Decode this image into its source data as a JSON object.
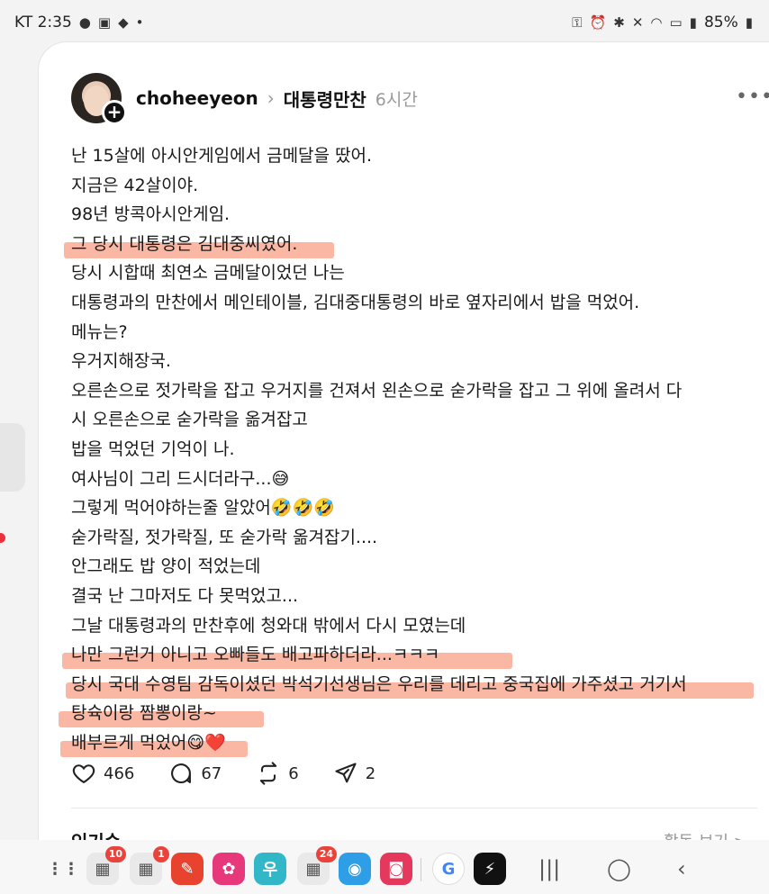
{
  "status_bar": {
    "carrier_time": "KT 2:35",
    "left_icons": [
      "location-icon",
      "gallery-icon",
      "chat-icon"
    ],
    "dot": "•",
    "battery": "85%"
  },
  "post": {
    "author": "choheeyeon",
    "topic": "대통령만찬",
    "time": "6시간",
    "lines": [
      "난 15살에 아시안게임에서 금메달을 땄어.",
      "지금은 42살이야.",
      "98년 방콕아시안게임.",
      "그 당시 대통령은 김대중씨였어.",
      "당시 시합때 최연소 금메달이었던 나는",
      "대통령과의 만찬에서 메인테이블, 김대중대통령의 바로 옆자리에서 밥을 먹었어.",
      "메뉴는?",
      "우거지해장국.",
      "오른손으로 젓가락을 잡고 우거지를 건져서 왼손으로 숟가락을 잡고 그 위에 올려서 다",
      "시 오른손으로 숟가락을 옮겨잡고",
      "밥을 먹었던 기억이 나.",
      "여사님이 그리 드시더라구...😅",
      "그렇게 먹어야하는줄 알았어🤣🤣🤣",
      "숟가락질, 젓가락질, 또 숟가락 옮겨잡기....",
      "안그래도 밥 양이 적었는데",
      "결국 난 그마저도 다 못먹었고...",
      "그날 대통령과의 만찬후에 청와대 밖에서 다시 모였는데",
      "나만 그런거 아니고 오빠들도 배고파하더라...ㅋㅋㅋ",
      "당시 국대 수영팀 감독이셨던 박석기선생님은 우리를 데리고 중국집에 가주셨고 거기서",
      "탕슉이랑 짬뽕이랑~",
      "배부르게 먹었어😋❤️"
    ],
    "highlighted_lines": [
      3,
      17,
      18,
      19,
      20
    ],
    "highlight_color": "#f67e5a",
    "actions": {
      "likes": "466",
      "comments": "67",
      "reposts": "6",
      "shares": "2"
    },
    "replies_label": "인기순 ⌄",
    "view_activity": "활동 보기 >"
  },
  "dock": {
    "apps": [
      {
        "name": "app-drawer-icon",
        "color": "#f7f7f7",
        "glyph": "⋮⋮",
        "badge": ""
      },
      {
        "name": "apps-folder-1-icon",
        "color": "#e9e9e9",
        "glyph": "▦",
        "badge": "10"
      },
      {
        "name": "apps-folder-2-icon",
        "color": "#e9e9e9",
        "glyph": "▦",
        "badge": "1"
      },
      {
        "name": "notes-app-icon",
        "color": "#e8432f",
        "glyph": "✎",
        "badge": ""
      },
      {
        "name": "flower-app-icon",
        "color": "#e6387b",
        "glyph": "✿",
        "badge": ""
      },
      {
        "name": "woori-bank-icon",
        "color": "#32b7c9",
        "glyph": "우",
        "badge": ""
      },
      {
        "name": "apps-folder-3-icon",
        "color": "#e9e9e9",
        "glyph": "▦",
        "badge": "24"
      },
      {
        "name": "camera-app-icon",
        "color": "#2e9ee6",
        "glyph": "◉",
        "badge": ""
      },
      {
        "name": "screen-recorder-icon",
        "color": "#e4385c",
        "glyph": "◙",
        "badge": ""
      },
      {
        "name": "google-icon",
        "color": "#ffffff",
        "glyph": "G",
        "badge": ""
      },
      {
        "name": "bolt-app-icon",
        "color": "#111111",
        "glyph": "⚡",
        "badge": ""
      }
    ],
    "nav": [
      "|||",
      "◯",
      "‹"
    ]
  }
}
